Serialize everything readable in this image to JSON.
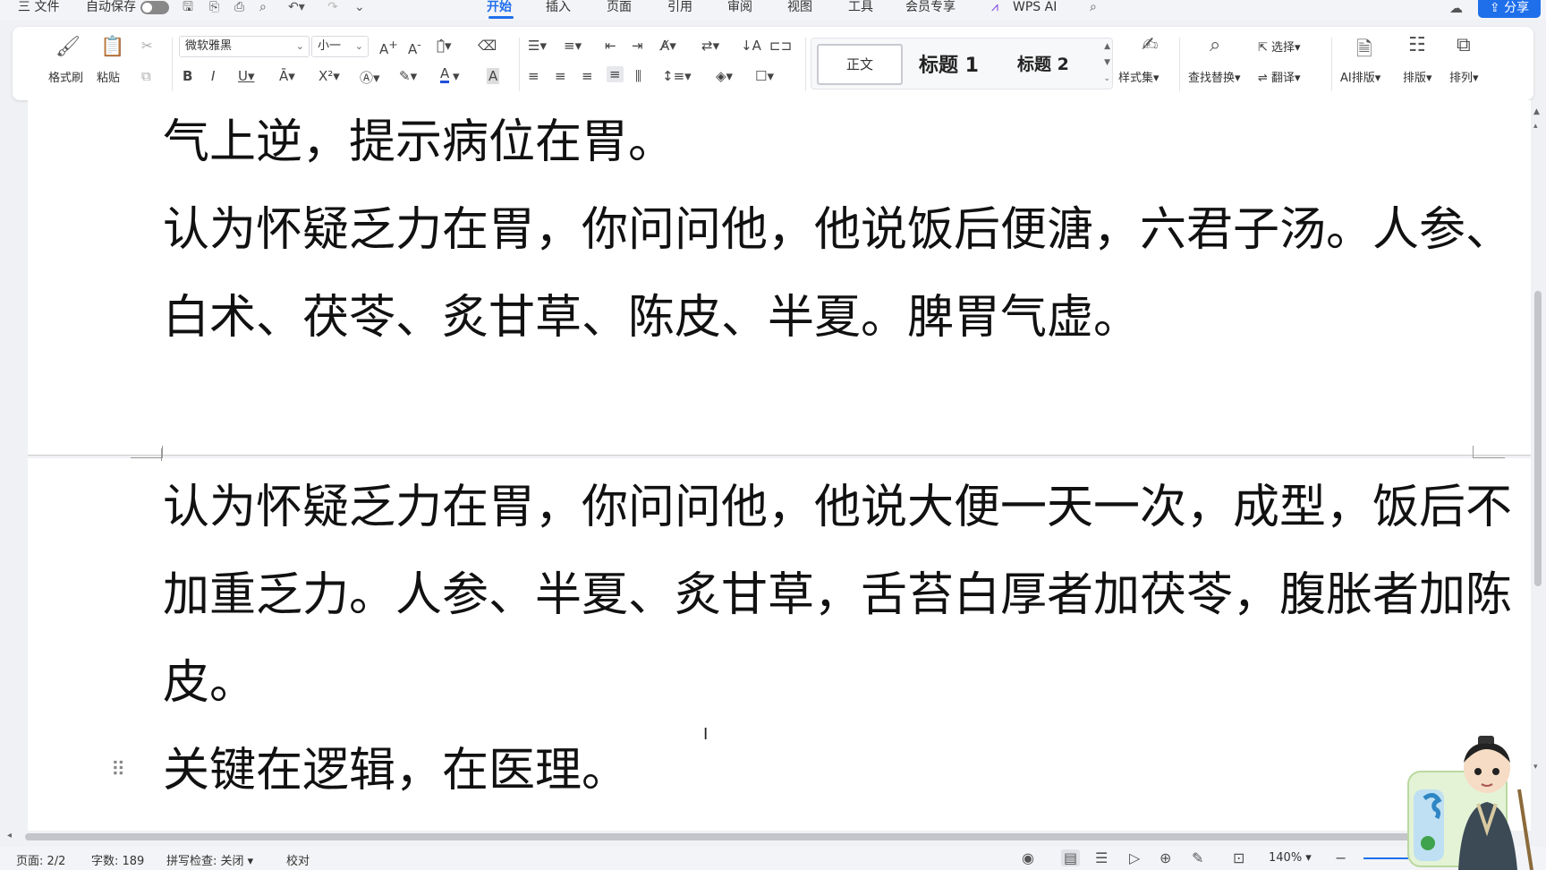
{
  "menu": {
    "file": "三 文件",
    "autosave": "自动保存",
    "tabs": [
      "开始",
      "插入",
      "页面",
      "引用",
      "审阅",
      "视图",
      "工具",
      "会员专享",
      "WPS AI"
    ],
    "share": "分享"
  },
  "ribbon": {
    "format_painter": "格式刷",
    "paste": "粘贴",
    "font_name": "微软雅黑",
    "font_size": "小一",
    "style_normal": "正文",
    "style_h1": "标题 1",
    "style_h2": "标题 2",
    "style_set": "样式集",
    "find_replace": "查找替换",
    "select": "选择",
    "translate": "翻译",
    "ai_layout": "AI排版",
    "layout": "排版",
    "arrange": "排列"
  },
  "document": {
    "page1": [
      "气上逆，提示病位在胃。",
      "认为怀疑乏力在胃，你问问他，他说饭后便溏，六君子汤。人参、",
      "白术、茯苓、炙甘草、陈皮、半夏。脾胃气虚。"
    ],
    "page2": [
      "认为怀疑乏力在胃，你问问他，他说大便一天一次，成型，饭后不",
      "加重乏力。人参、半夏、炙甘草，舌苔白厚者加茯苓，腹胀者加陈",
      "皮。",
      "关键在逻辑，在医理。"
    ]
  },
  "status": {
    "page": "页面: 2/2",
    "word_count": "字数: 189",
    "spell_check": "拼写检查: 关闭",
    "proofread": "校对",
    "zoom": "140%"
  },
  "colors": {
    "accent": "#1f6feb"
  }
}
